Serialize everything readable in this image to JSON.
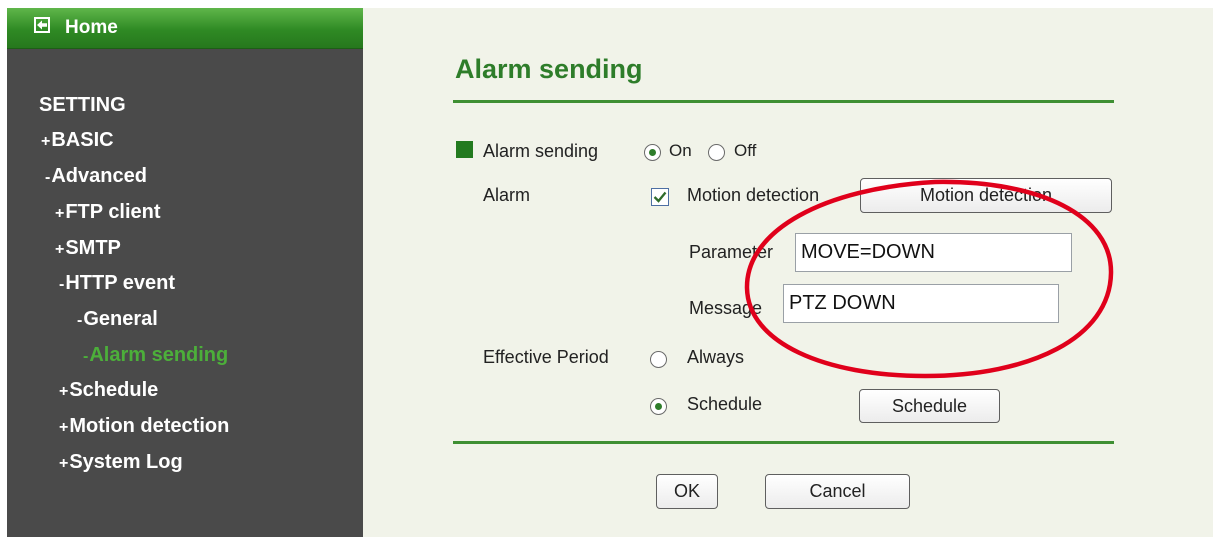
{
  "sidebar": {
    "home_label": "Home",
    "items": [
      {
        "prefix": "",
        "label": "SETTING"
      },
      {
        "prefix": "+",
        "label": "BASIC"
      },
      {
        "prefix": "-",
        "label": "Advanced"
      },
      {
        "prefix": "+",
        "label": "FTP client"
      },
      {
        "prefix": "+",
        "label": "SMTP"
      },
      {
        "prefix": "-",
        "label": "HTTP event"
      },
      {
        "prefix": "-",
        "label": "General"
      },
      {
        "prefix": "-",
        "label": "Alarm sending"
      },
      {
        "prefix": "+",
        "label": "Schedule"
      },
      {
        "prefix": "+",
        "label": "Motion detection"
      },
      {
        "prefix": "+",
        "label": "System Log"
      }
    ]
  },
  "main": {
    "title": "Alarm sending",
    "alarm_sending": {
      "label": "Alarm sending",
      "on_label": "On",
      "off_label": "Off",
      "selected": "On"
    },
    "alarm": {
      "label": "Alarm",
      "motion_label": "Motion detection",
      "motion_checked": true,
      "motion_button": "Motion detection",
      "parameter_label": "Parameter",
      "parameter_value": "MOVE=DOWN",
      "message_label": "Message",
      "message_value": "PTZ DOWN"
    },
    "effective_period": {
      "label": "Effective Period",
      "always_label": "Always",
      "schedule_label": "Schedule",
      "selected": "Schedule",
      "schedule_button": "Schedule"
    },
    "ok_button": "OK",
    "cancel_button": "Cancel"
  },
  "colors": {
    "accent_green": "#2e7d2a",
    "sidebar_bg": "#4a4a4a",
    "main_bg": "#f1f3e9",
    "annotation_red": "#e0001b"
  },
  "icons": {
    "home": "back-arrow-icon",
    "bullet": "square-bullet-icon"
  }
}
